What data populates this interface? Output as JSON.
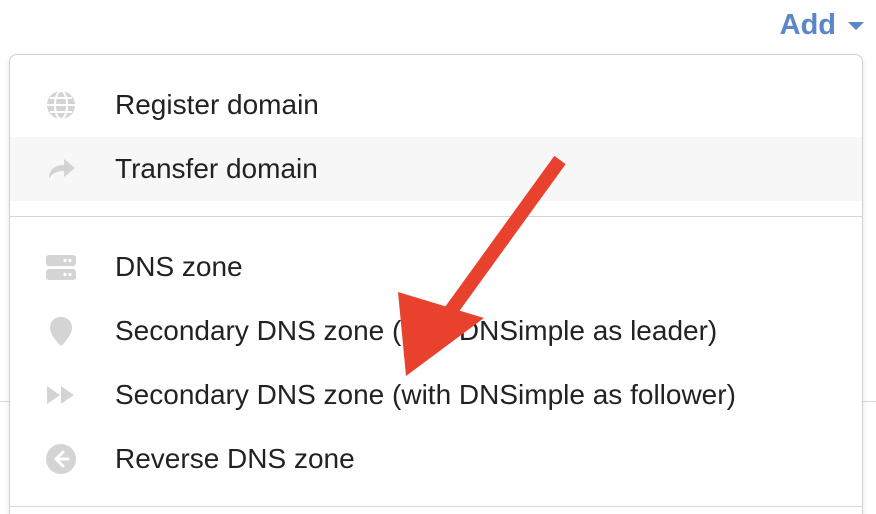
{
  "header": {
    "add_label": "Add",
    "accent_color": "#5b86c9"
  },
  "menu": {
    "groups": [
      {
        "items": [
          {
            "label": "Register domain",
            "icon": "globe-icon"
          },
          {
            "label": "Transfer domain",
            "icon": "share-arrow-icon",
            "hovered": true
          }
        ]
      },
      {
        "items": [
          {
            "label": "DNS zone",
            "icon": "server-icon"
          },
          {
            "label": "Secondary DNS zone (with DNSimple as leader)",
            "icon": "map-pin-icon"
          },
          {
            "label": "Secondary DNS zone (with DNSimple as follower)",
            "icon": "fast-forward-icon"
          },
          {
            "label": "Reverse DNS zone",
            "icon": "circle-arrow-left-icon"
          }
        ]
      }
    ]
  },
  "annotation": {
    "icon": "red-arrow-icon",
    "color": "#e8422e"
  }
}
